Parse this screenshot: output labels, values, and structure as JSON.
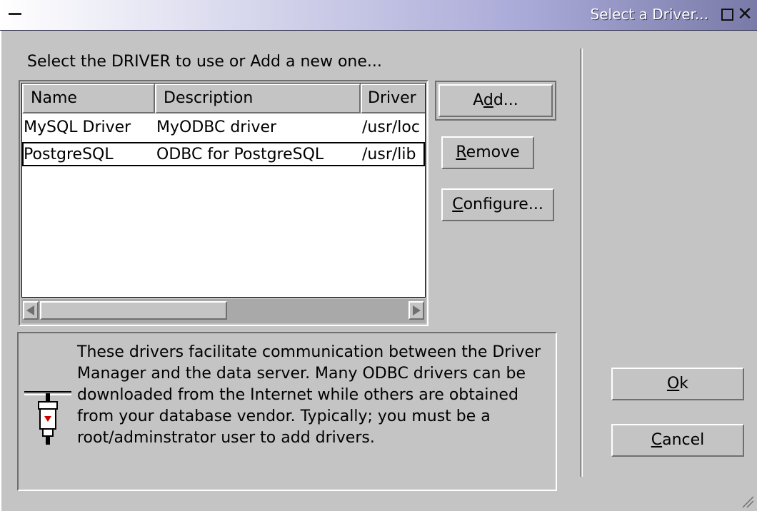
{
  "window": {
    "title": "Select a Driver...",
    "close_glyph": "✕"
  },
  "prompt": "Select the DRIVER to use or Add a new one...",
  "list": {
    "columns": [
      "Name",
      "Description",
      "Driver"
    ],
    "rows": [
      {
        "name": "MySQL Driver",
        "description": "MyODBC driver",
        "driver": "/usr/loc"
      },
      {
        "name": "PostgreSQL",
        "description": "ODBC for PostgreSQL",
        "driver": "/usr/lib"
      }
    ],
    "selected_row": 1
  },
  "buttons": {
    "add": {
      "pre": "A",
      "key": "d",
      "post": "d..."
    },
    "remove": {
      "pre": "",
      "key": "R",
      "post": "emove"
    },
    "configure": {
      "pre": "",
      "key": "C",
      "post": "onfigure..."
    },
    "ok": {
      "pre": "",
      "key": "O",
      "post": "k"
    },
    "cancel": {
      "pre": "",
      "key": "C",
      "post": "ancel"
    }
  },
  "info": {
    "text": "These drivers facilitate communication between the Driver Manager and the data server. Many ODBC drivers can be downloaded from the Internet while others are obtained from your database vendor. Typically; you must be a root/adminstrator user to add drivers.",
    "icon": "plug-icon"
  },
  "colors": {
    "face": "#c4c4c4",
    "shadow": "#6f6f6f",
    "highlight": "#ffffff",
    "plug_red": "#cc0000"
  }
}
